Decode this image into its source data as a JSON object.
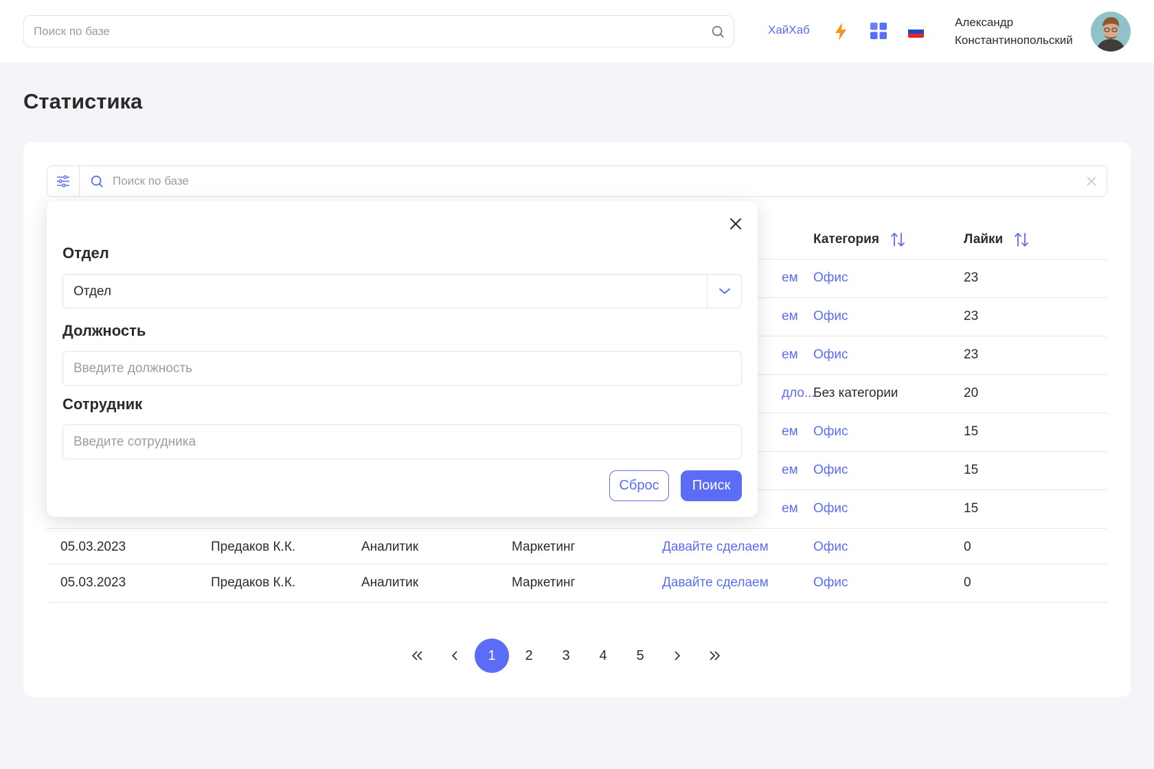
{
  "header": {
    "search_placeholder": "Поиск по базе",
    "brand_link": "ХайХаб",
    "user_name_line1": "Александр",
    "user_name_line2": "Константинопольский"
  },
  "page": {
    "title": "Статистика"
  },
  "filter_bar": {
    "search_placeholder": "Поиск по базе"
  },
  "table": {
    "visible_headers": [
      {
        "label": "Категория",
        "sortable": true
      },
      {
        "label": "Лайки",
        "sortable": true
      }
    ],
    "rows": [
      {
        "date": "",
        "employee": "",
        "position": "",
        "department": "",
        "title": "ем",
        "category": "Офис",
        "likes": "23"
      },
      {
        "date": "",
        "employee": "",
        "position": "",
        "department": "",
        "title": "ем",
        "category": "Офис",
        "likes": "23"
      },
      {
        "date": "",
        "employee": "",
        "position": "",
        "department": "",
        "title": "ем",
        "category": "Офис",
        "likes": "23"
      },
      {
        "date": "",
        "employee": "",
        "position": "",
        "department": "",
        "title": "дло...",
        "category": "Без категории",
        "likes": "20"
      },
      {
        "date": "",
        "employee": "",
        "position": "",
        "department": "",
        "title": "ем",
        "category": "Офис",
        "likes": "15"
      },
      {
        "date": "",
        "employee": "",
        "position": "",
        "department": "",
        "title": "ем",
        "category": "Офис",
        "likes": "15"
      },
      {
        "date": "",
        "employee": "",
        "position": "",
        "department": "",
        "title": "ем",
        "category": "Офис",
        "likes": "15"
      },
      {
        "date": "05.03.2023",
        "employee": "Предаков К.К.",
        "position": "Аналитик",
        "department": "Маркетинг",
        "title": "Давайте сделаем",
        "category": "Офис",
        "likes": "0"
      },
      {
        "date": "05.03.2023",
        "employee": "Предаков К.К.",
        "position": "Аналитик",
        "department": "Маркетинг",
        "title": "Давайте сделаем",
        "category": "Офис",
        "likes": "0"
      }
    ]
  },
  "pagination": {
    "pages": [
      "1",
      "2",
      "3",
      "4",
      "5"
    ],
    "current": "1"
  },
  "filter_popup": {
    "department_label": "Отдел",
    "department_value": "Отдел",
    "position_label": "Должность",
    "position_placeholder": "Введите должность",
    "employee_label": "Сотрудник",
    "employee_placeholder": "Введите сотрудника",
    "reset_label": "Сброс",
    "search_label": "Поиск"
  },
  "colors": {
    "accent": "#5b6cf6",
    "bolt": "#f7931e",
    "background": "#f4f5f8"
  },
  "icons": [
    "search-icon",
    "lightning-icon",
    "apps-grid-icon",
    "russia-flag-icon",
    "avatar",
    "filter-sliders-icon",
    "clear-icon",
    "sort-icon",
    "close-icon",
    "chevron-down-icon",
    "double-chevron-left-icon",
    "chevron-left-icon",
    "chevron-right-icon",
    "double-chevron-right-icon"
  ]
}
